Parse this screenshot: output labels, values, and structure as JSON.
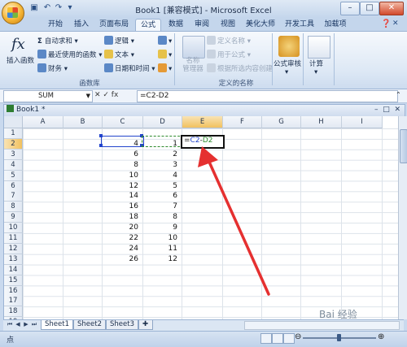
{
  "window": {
    "title": "Book1",
    "compat_mode": "[兼容模式]",
    "app_name": "- Microsoft Excel",
    "minimize": "–",
    "maximize": "□",
    "close": "✕"
  },
  "ribbon_tabs": [
    {
      "label": "开始",
      "active": false
    },
    {
      "label": "插入",
      "active": false
    },
    {
      "label": "页面布局",
      "active": false
    },
    {
      "label": "公式",
      "active": true
    },
    {
      "label": "数据",
      "active": false
    },
    {
      "label": "审阅",
      "active": false
    },
    {
      "label": "视图",
      "active": false
    },
    {
      "label": "美化大师",
      "active": false
    },
    {
      "label": "开发工具",
      "active": false
    },
    {
      "label": "加载项",
      "active": false
    }
  ],
  "ribbon": {
    "function_library": {
      "insert_function": "插入函数",
      "autosum": "自动求和",
      "recent": "最近使用的函数",
      "financial": "财务",
      "logical": "逻辑",
      "text": "文本",
      "datetime": "日期和时间",
      "label": "函数库"
    },
    "defined_names": {
      "name_manager_line1": "名称",
      "name_manager_line2": "管理器",
      "define_name": "定义名称",
      "use_in_formula": "用于公式",
      "create_from_selection": "根据所选内容创建",
      "label": "定义的名称"
    },
    "formula_auditing": "公式审核",
    "calculation": "计算"
  },
  "formula_bar": {
    "name_box": "SUM",
    "buttons": "✕ ✓ fx",
    "formula": "=C2-D2"
  },
  "workbook": {
    "name": "Book1 *"
  },
  "columns": [
    "A",
    "B",
    "C",
    "D",
    "E",
    "F",
    "G",
    "H",
    "I"
  ],
  "rows": [
    "1",
    "2",
    "3",
    "4",
    "5",
    "6",
    "7",
    "8",
    "9",
    "10",
    "11",
    "12",
    "13",
    "14",
    "15",
    "16",
    "17",
    "18",
    "19"
  ],
  "cells": {
    "C": [
      "",
      "4",
      "6",
      "8",
      "10",
      "12",
      "14",
      "16",
      "18",
      "20",
      "22",
      "24",
      "26"
    ],
    "D": [
      "",
      "1",
      "2",
      "3",
      "4",
      "5",
      "6",
      "7",
      "8",
      "9",
      "10",
      "11",
      "12"
    ]
  },
  "editing_cell": {
    "prefix": "=",
    "ref1": "C2",
    "minus": "-",
    "ref2": "D2"
  },
  "sheets": [
    "Sheet1",
    "Sheet2",
    "Sheet3"
  ],
  "status": {
    "mode": "点",
    "watermark": "Bai 经验"
  },
  "colors": {
    "ref1_color": "#2244cc",
    "ref2_color": "#2d8a2d",
    "arrow": "#e53030"
  }
}
